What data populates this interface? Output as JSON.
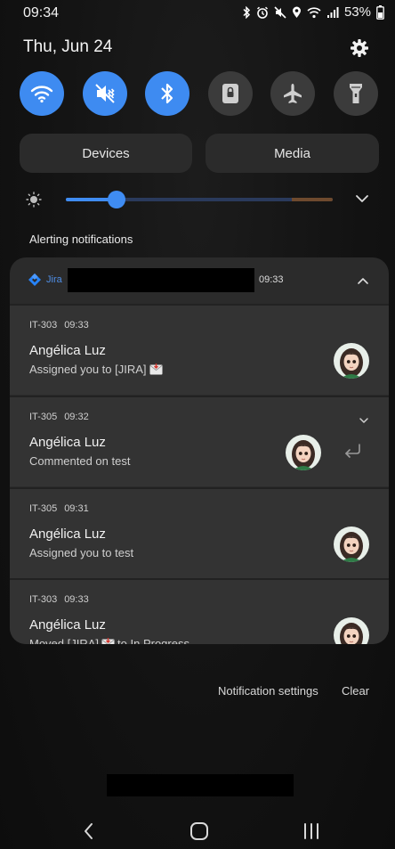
{
  "status_bar": {
    "time": "09:34",
    "battery_percent": "53%",
    "icons": [
      "bluetooth-icon",
      "alarm-icon",
      "mute-icon",
      "location-icon",
      "wifi-icon",
      "signal-icon",
      "battery-icon"
    ]
  },
  "header": {
    "date": "Thu, Jun 24",
    "settings_icon": "gear-icon"
  },
  "quick_toggles": [
    {
      "name": "wifi",
      "icon": "wifi-icon",
      "on": true
    },
    {
      "name": "sound",
      "icon": "mute-icon",
      "on": true
    },
    {
      "name": "bluetooth",
      "icon": "bluetooth-icon",
      "on": true
    },
    {
      "name": "rotation-lock",
      "icon": "lock-icon",
      "on": false
    },
    {
      "name": "airplane-mode",
      "icon": "airplane-icon",
      "on": false
    },
    {
      "name": "flashlight",
      "icon": "flashlight-icon",
      "on": false
    }
  ],
  "panels": {
    "devices_label": "Devices",
    "media_label": "Media"
  },
  "brightness": {
    "level_fraction": 0.19
  },
  "alerting": {
    "header": "Alerting notifications"
  },
  "app_group": {
    "app_name": "Jira",
    "time": "09:33"
  },
  "notifications": [
    {
      "key": "IT-303",
      "time": "09:33",
      "sender": "Angélica Luz",
      "body_before": "Assigned you to [JIRA]",
      "has_mail": true,
      "body_after": ""
    },
    {
      "key": "IT-305",
      "time": "09:32",
      "sender": "Angélica Luz",
      "body_before": "Commented on test",
      "has_mail": false,
      "body_after": ""
    },
    {
      "key": "IT-305",
      "time": "09:31",
      "sender": "Angélica Luz",
      "body_before": "Assigned you to test",
      "has_mail": false,
      "body_after": ""
    },
    {
      "key": "IT-303",
      "time": "09:33",
      "sender": "Angélica Luz",
      "body_before": "Moved [JIRA]",
      "has_mail": true,
      "body_after": "to In Progress"
    }
  ],
  "footer": {
    "settings_label": "Notification settings",
    "clear_label": "Clear"
  },
  "colors": {
    "accent": "#3e8bf1",
    "background": "#121212",
    "card": "#333333",
    "jira_blue": "#2684ff"
  }
}
